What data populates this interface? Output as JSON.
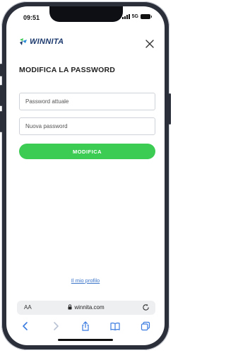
{
  "status_bar": {
    "time": "09:51",
    "network": "5G"
  },
  "header": {
    "logo_text": "WINNITA",
    "logo_icon": "winnita-logo-icon",
    "close_icon": "close-icon"
  },
  "form": {
    "title": "MODIFICA LA PASSWORD",
    "current_password_placeholder": "Password attuale",
    "new_password_placeholder": "Nuova password",
    "submit_label": "MODIFICA"
  },
  "profile_link": "Il mio profilo",
  "browser": {
    "text_size_label": "AA",
    "url": "winnita.com",
    "toolbar_icons": [
      "back-icon",
      "forward-icon",
      "share-icon",
      "bookmarks-icon",
      "tabs-icon"
    ]
  },
  "colors": {
    "accent_green": "#3ccc54",
    "brand_navy": "#1d3a6e",
    "link_blue": "#3a74c9"
  }
}
